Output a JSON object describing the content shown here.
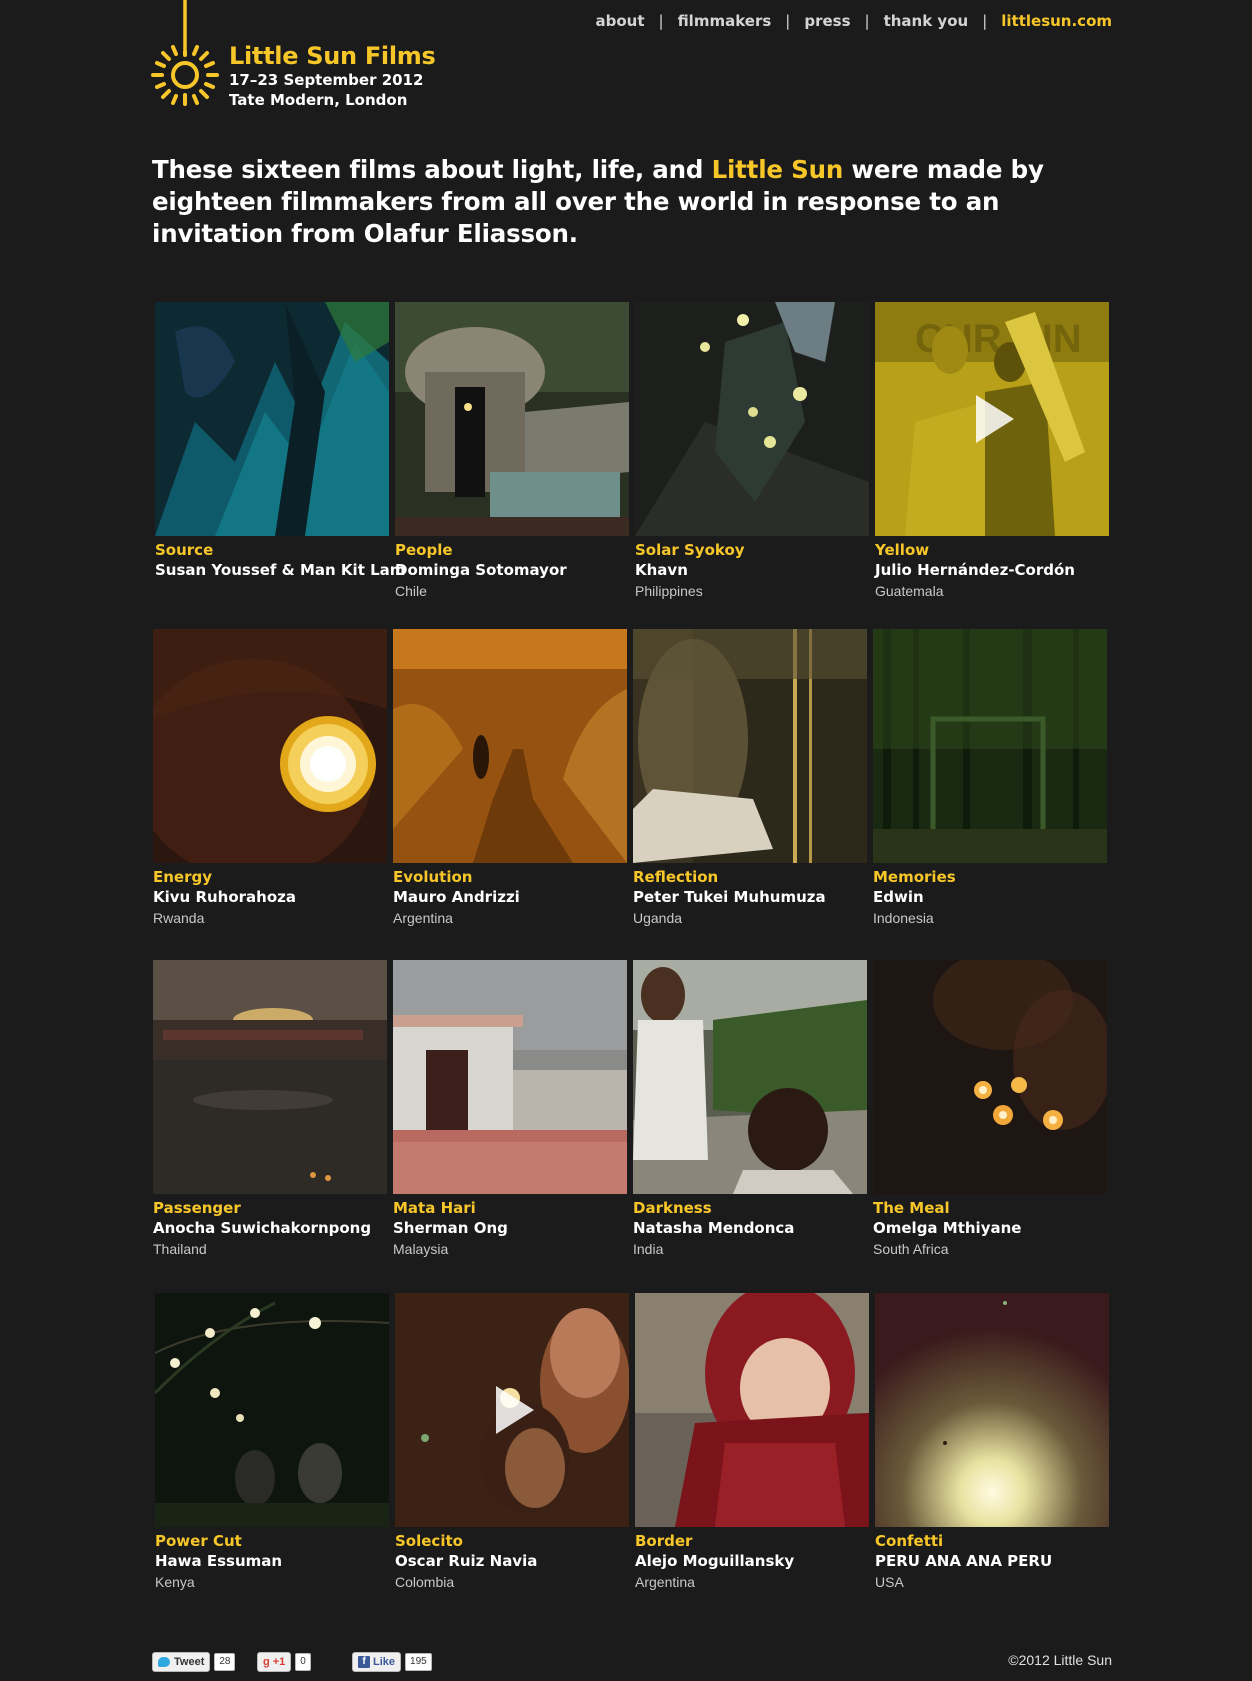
{
  "nav": {
    "items": [
      {
        "label": "about"
      },
      {
        "label": "filmmakers"
      },
      {
        "label": "press"
      },
      {
        "label": "thank you"
      },
      {
        "label": "littlesun.com"
      }
    ]
  },
  "brand": {
    "title": "Little Sun Films",
    "dates": "17–23 September 2012",
    "venue": "Tate Modern, London"
  },
  "intro": {
    "before": "These sixteen films about light, life, and ",
    "highlight": "Little Sun",
    "after": " were made by eighteen filmmakers from all over the world in response to an invitation from Olafur Eliasson."
  },
  "films": [
    {
      "title": "Source",
      "maker": "Susan Youssef & Man Kit Lam",
      "country": ""
    },
    {
      "title": "People",
      "maker": "Dominga Sotomayor",
      "country": "Chile"
    },
    {
      "title": "Solar Syokoy",
      "maker": "Khavn",
      "country": "Philippines"
    },
    {
      "title": "Yellow",
      "maker": "Julio Hernández-Cordón",
      "country": "Guatemala"
    },
    {
      "title": "Energy",
      "maker": "Kivu Ruhorahoza",
      "country": "Rwanda"
    },
    {
      "title": "Evolution",
      "maker": "Mauro Andrizzi",
      "country": "Argentina"
    },
    {
      "title": "Reflection",
      "maker": "Peter Tukei Muhumuza",
      "country": "Uganda"
    },
    {
      "title": "Memories",
      "maker": "Edwin",
      "country": "Indonesia"
    },
    {
      "title": "Passenger",
      "maker": "Anocha Suwichakornpong",
      "country": "Thailand"
    },
    {
      "title": "Mata Hari",
      "maker": "Sherman Ong",
      "country": "Malaysia"
    },
    {
      "title": "Darkness",
      "maker": "Natasha Mendonca",
      "country": "India"
    },
    {
      "title": "The Meal",
      "maker": "Omelga Mthiyane",
      "country": "South Africa"
    },
    {
      "title": "Power Cut",
      "maker": "Hawa Essuman",
      "country": "Kenya"
    },
    {
      "title": "Solecito",
      "maker": "Oscar Ruiz Navia",
      "country": "Colombia"
    },
    {
      "title": "Border",
      "maker": "Alejo Moguillansky",
      "country": "Argentina"
    },
    {
      "title": "Confetti",
      "maker": "PERU ANA ANA PERU",
      "country": "USA"
    }
  ],
  "footer": {
    "tweet_label": "Tweet",
    "tweet_count": "28",
    "gplus_label": "+1",
    "gplus_count": "0",
    "like_label": "Like",
    "like_count": "195",
    "copyright": "©2012 Little Sun"
  },
  "colors": {
    "background": "#1c1b1b",
    "accent": "#f7c72a",
    "text": "#ffffff",
    "muted": "#c8c8c8"
  }
}
